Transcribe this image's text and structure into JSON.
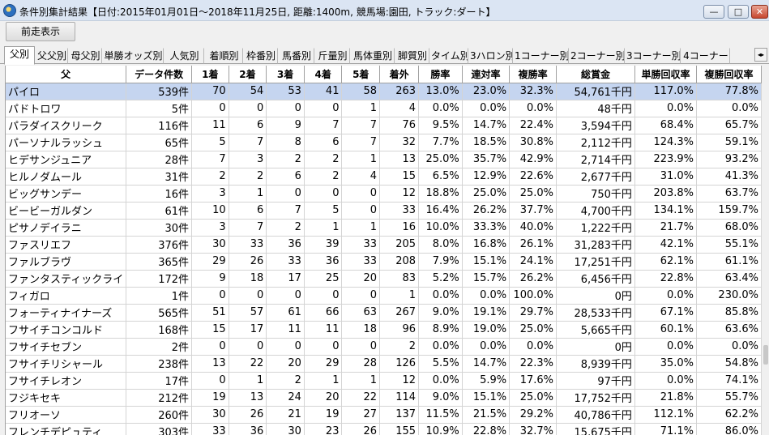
{
  "window": {
    "title": "条件別集計結果【日付:2015年01月01日～2018年11月25日, 距離:1400m, 競馬場:園田, トラック:ダート】",
    "minimize": "—",
    "maximize": "□",
    "close": "✕"
  },
  "toolbar": {
    "prev_label": "前走表示"
  },
  "tabs": [
    "父別",
    "父父別",
    "母父別",
    "単勝オッズ別",
    "人気別",
    "着順別",
    "枠番別",
    "馬番別",
    "斤量別",
    "馬体重別",
    "脚質別",
    "タイム別",
    "3ハロン別",
    "1コーナー別",
    "2コーナー別",
    "3コーナー別",
    "4コーナー"
  ],
  "tab_scroll_icon": "◂▸",
  "table": {
    "headers": [
      "父",
      "データ件数",
      "1着",
      "2着",
      "3着",
      "4着",
      "5着",
      "着外",
      "勝率",
      "連対率",
      "複勝率",
      "総賞金",
      "単勝回収率",
      "複勝回収率"
    ],
    "rows": [
      [
        "パイロ",
        "539件",
        "70",
        "54",
        "53",
        "41",
        "58",
        "263",
        "13.0%",
        "23.0%",
        "32.3%",
        "54,761千円",
        "117.0%",
        "77.8%"
      ],
      [
        "パドトロワ",
        "5件",
        "0",
        "0",
        "0",
        "0",
        "1",
        "4",
        "0.0%",
        "0.0%",
        "0.0%",
        "48千円",
        "0.0%",
        "0.0%"
      ],
      [
        "パラダイスクリーク",
        "116件",
        "11",
        "6",
        "9",
        "7",
        "7",
        "76",
        "9.5%",
        "14.7%",
        "22.4%",
        "3,594千円",
        "68.4%",
        "65.7%"
      ],
      [
        "パーソナルラッシュ",
        "65件",
        "5",
        "7",
        "8",
        "6",
        "7",
        "32",
        "7.7%",
        "18.5%",
        "30.8%",
        "2,112千円",
        "124.3%",
        "59.1%"
      ],
      [
        "ヒデサンジュニア",
        "28件",
        "7",
        "3",
        "2",
        "2",
        "1",
        "13",
        "25.0%",
        "35.7%",
        "42.9%",
        "2,714千円",
        "223.9%",
        "93.2%"
      ],
      [
        "ヒルノダムール",
        "31件",
        "2",
        "2",
        "6",
        "2",
        "4",
        "15",
        "6.5%",
        "12.9%",
        "22.6%",
        "2,677千円",
        "31.0%",
        "41.3%"
      ],
      [
        "ビッグサンデー",
        "16件",
        "3",
        "1",
        "0",
        "0",
        "0",
        "12",
        "18.8%",
        "25.0%",
        "25.0%",
        "750千円",
        "203.8%",
        "63.7%"
      ],
      [
        "ビービーガルダン",
        "61件",
        "10",
        "6",
        "7",
        "5",
        "0",
        "33",
        "16.4%",
        "26.2%",
        "37.7%",
        "4,700千円",
        "134.1%",
        "159.7%"
      ],
      [
        "ピサノデイラニ",
        "30件",
        "3",
        "7",
        "2",
        "1",
        "1",
        "16",
        "10.0%",
        "33.3%",
        "40.0%",
        "1,222千円",
        "21.7%",
        "68.0%"
      ],
      [
        "ファスリエフ",
        "376件",
        "30",
        "33",
        "36",
        "39",
        "33",
        "205",
        "8.0%",
        "16.8%",
        "26.1%",
        "31,283千円",
        "42.1%",
        "55.1%"
      ],
      [
        "ファルブラヴ",
        "365件",
        "29",
        "26",
        "33",
        "36",
        "33",
        "208",
        "7.9%",
        "15.1%",
        "24.1%",
        "17,251千円",
        "62.1%",
        "61.1%"
      ],
      [
        "ファンタスティックライ",
        "172件",
        "9",
        "18",
        "17",
        "25",
        "20",
        "83",
        "5.2%",
        "15.7%",
        "26.2%",
        "6,456千円",
        "22.8%",
        "63.4%"
      ],
      [
        "フィガロ",
        "1件",
        "0",
        "0",
        "0",
        "0",
        "0",
        "1",
        "0.0%",
        "0.0%",
        "100.0%",
        "0円",
        "0.0%",
        "230.0%"
      ],
      [
        "フォーティナイナーズ",
        "565件",
        "51",
        "57",
        "61",
        "66",
        "63",
        "267",
        "9.0%",
        "19.1%",
        "29.7%",
        "28,533千円",
        "67.1%",
        "85.8%"
      ],
      [
        "フサイチコンコルド",
        "168件",
        "15",
        "17",
        "11",
        "11",
        "18",
        "96",
        "8.9%",
        "19.0%",
        "25.0%",
        "5,665千円",
        "60.1%",
        "63.6%"
      ],
      [
        "フサイチセブン",
        "2件",
        "0",
        "0",
        "0",
        "0",
        "0",
        "2",
        "0.0%",
        "0.0%",
        "0.0%",
        "0円",
        "0.0%",
        "0.0%"
      ],
      [
        "フサイチリシャール",
        "238件",
        "13",
        "22",
        "20",
        "29",
        "28",
        "126",
        "5.5%",
        "14.7%",
        "22.3%",
        "8,939千円",
        "35.0%",
        "54.8%"
      ],
      [
        "フサイチレオン",
        "17件",
        "0",
        "1",
        "2",
        "1",
        "1",
        "12",
        "0.0%",
        "5.9%",
        "17.6%",
        "97千円",
        "0.0%",
        "74.1%"
      ],
      [
        "フジキセキ",
        "212件",
        "19",
        "13",
        "24",
        "20",
        "22",
        "114",
        "9.0%",
        "15.1%",
        "25.0%",
        "17,752千円",
        "21.8%",
        "55.7%"
      ],
      [
        "フリオーソ",
        "260件",
        "30",
        "26",
        "21",
        "19",
        "27",
        "137",
        "11.5%",
        "21.5%",
        "29.2%",
        "40,786千円",
        "112.1%",
        "62.2%"
      ],
      [
        "フレンチデピュティ",
        "303件",
        "33",
        "36",
        "30",
        "23",
        "26",
        "155",
        "10.9%",
        "22.8%",
        "32.7%",
        "15,675千円",
        "71.1%",
        "86.0%"
      ]
    ]
  }
}
